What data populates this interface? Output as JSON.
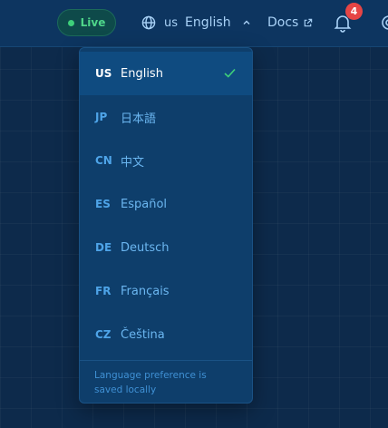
{
  "header": {
    "status_label": "Live",
    "language_code": "us",
    "language_label": "English",
    "docs_label": "Docs",
    "notification_count": "4"
  },
  "language_menu": {
    "items": [
      {
        "code": "US",
        "label": "English",
        "selected": true
      },
      {
        "code": "JP",
        "label": "日本語",
        "selected": false
      },
      {
        "code": "CN",
        "label": "中文",
        "selected": false
      },
      {
        "code": "ES",
        "label": "Español",
        "selected": false
      },
      {
        "code": "DE",
        "label": "Deutsch",
        "selected": false
      },
      {
        "code": "FR",
        "label": "Français",
        "selected": false
      },
      {
        "code": "CZ",
        "label": "Čeština",
        "selected": false
      }
    ],
    "footer_note": "Language preference is saved locally"
  },
  "colors": {
    "background": "#0d2a4b",
    "topbar": "#0d3560",
    "menu_bg": "#0e3e6b",
    "selected_bg": "#0f4b80",
    "accent_text": "#6bb6f0",
    "live_green": "#3ecf7a",
    "badge_red": "#e64545",
    "check_green": "#3ecf7a"
  },
  "icons": [
    "globe-icon",
    "chevron-up-icon",
    "external-link-icon",
    "bell-icon",
    "gear-icon",
    "check-icon"
  ]
}
